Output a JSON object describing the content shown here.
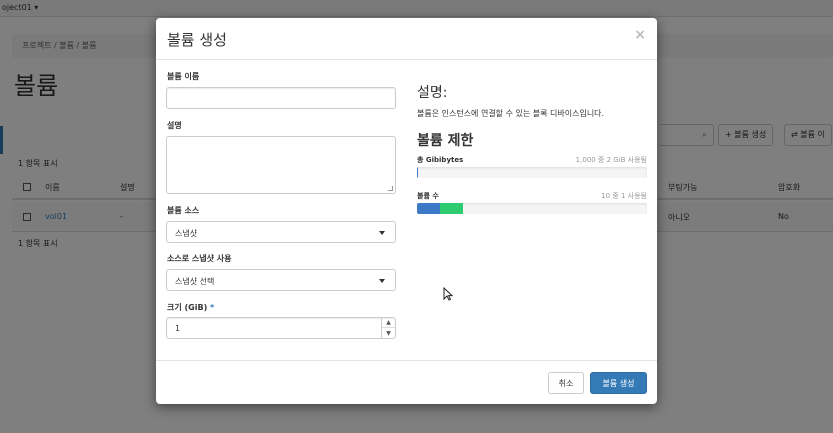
{
  "topbar": {
    "project": "oject01 ▾"
  },
  "page": {
    "breadcrumb": "프로젝트 /  볼륨 /  볼륨",
    "title": "볼륨",
    "count_top": "1 항목 표시",
    "count_bottom": "1 항목 표시",
    "actions": {
      "create": "+ 볼륨 생성",
      "accept": "⇄ 볼륨 이"
    },
    "table": {
      "headers": {
        "name": "이름",
        "description": "설명",
        "bootable": "부팅가능",
        "encrypted": "암호화"
      },
      "rows": [
        {
          "name": "vol01",
          "description": "-",
          "bootable": "아니오",
          "encrypted": "No"
        }
      ]
    }
  },
  "modal": {
    "title": "볼륨 생성",
    "close": "×",
    "fields": {
      "name_label": "볼륨 이름",
      "name_value": "",
      "description_label": "설명",
      "source_label": "볼륨 소스",
      "source_value": "스냅샷",
      "snapshot_label": "소스로 스냅샷 사용",
      "snapshot_value": "스냅샷 선택",
      "size_label": "크기 (GiB)",
      "size_required": "*",
      "size_value": "1"
    },
    "info": {
      "description_title": "설명:",
      "description_text": "볼륨은 인스턴스에 연결할 수 있는 블록 디바이스입니다.",
      "quota_title": "볼륨 제한",
      "gb_label": "총 Gibibytes",
      "gb_value": "1,000 중 2 GiB 사용됨",
      "gb_used_fraction": 0.002,
      "count_label": "볼륨 수",
      "count_value": "10 중 1 사용됨",
      "count_used_fraction": 0.1,
      "count_new_fraction": 0.1
    },
    "footer": {
      "cancel": "취소",
      "submit": "볼륨 생성"
    }
  },
  "colors": {
    "primary": "#337ab7",
    "bar_used": "#3c78c6",
    "bar_new": "#2ecc71"
  }
}
